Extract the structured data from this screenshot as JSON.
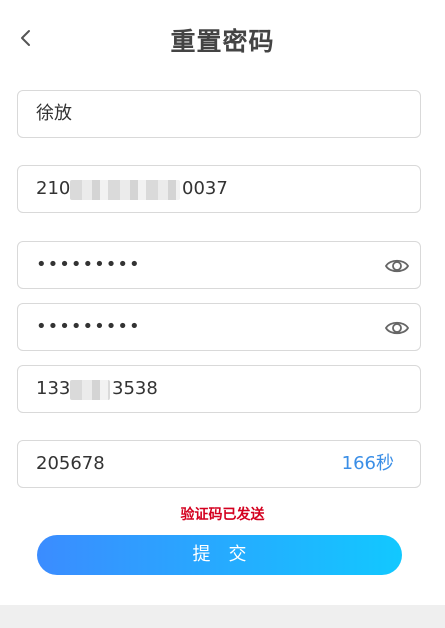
{
  "header": {
    "title": "重置密码"
  },
  "form": {
    "name": "徐放",
    "id_number_prefix": "210",
    "id_number_suffix": "0037",
    "password_mask": "•••••••••",
    "confirm_password_mask": "•••••••••",
    "phone_prefix": "133",
    "phone_suffix": "3538",
    "verification_code": "205678",
    "countdown": "166秒"
  },
  "status": {
    "message": "验证码已发送",
    "color": "#d4001f"
  },
  "submit": {
    "label": "提交"
  },
  "icons": {
    "back": "chevron-left-icon",
    "toggle_visibility": "eye-icon"
  },
  "colors": {
    "accent": "#3a8ee6",
    "button_start": "#3b8cff",
    "button_end": "#12c8ff"
  }
}
